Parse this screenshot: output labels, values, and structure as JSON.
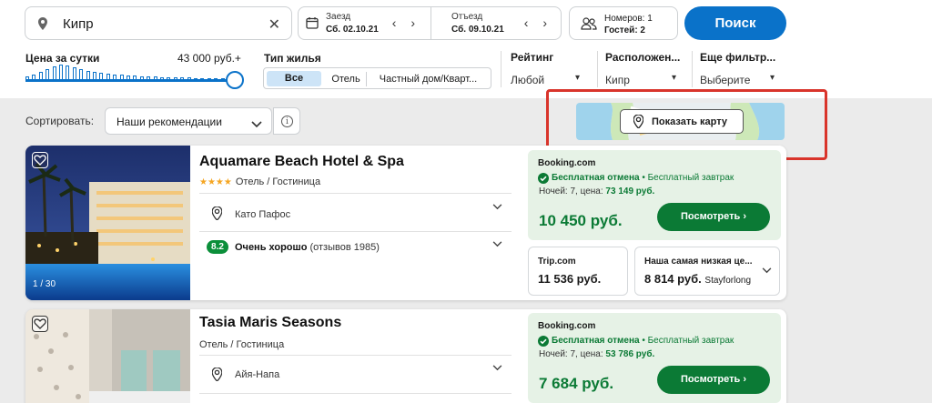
{
  "search": {
    "destination": "Кипр",
    "clear_icon": "close-icon",
    "checkin_label": "Заезд",
    "checkin_value": "Сб. 02.10.21",
    "checkout_label": "Отъезд",
    "checkout_value": "Сб. 09.10.21",
    "rooms": "Номеров: 1",
    "guests": "Гостей: 2",
    "button": "Поиск"
  },
  "filters": {
    "price_label": "Цена за сутки",
    "price_value": "43 000 руб.+",
    "price_slider_level": 1.0,
    "type_label": "Тип жилья",
    "type_options": [
      "Все",
      "Отель",
      "Частный дом/Кварт..."
    ],
    "type_selected": "Все",
    "rating_label": "Рейтинг",
    "rating_value": "Любой",
    "location_label": "Расположен...",
    "location_value": "Кипр",
    "more_label": "Еще фильтр...",
    "more_value": "Выберите"
  },
  "sort": {
    "label": "Сортировать:",
    "value": "Наши рекомендации"
  },
  "map": {
    "button": "Показать карту"
  },
  "hotels": [
    {
      "name": "Aquamare Beach Hotel & Spa",
      "stars": "★★★★",
      "type": "Отель / Гостиница",
      "location": "Като Пафос",
      "score": "8.2",
      "score_text": "Очень хорошо",
      "reviews": "(отзывов 1985)",
      "photo_counter": "1 / 30",
      "deal": {
        "source": "Booking.com",
        "perk_main": "Бесплатная отмена",
        "perk_extra": " • Бесплатный завтрак",
        "nights_prefix": "Ночей: 7, цена: ",
        "nights_total": "73 149 руб.",
        "price": "10 450 руб.",
        "button": "Посмотреть"
      },
      "alternatives": [
        {
          "name": "Trip.com",
          "price": "11 536 руб.",
          "via": ""
        },
        {
          "name": "Наша самая низкая це...",
          "price": "8 814 руб.",
          "via": "Stayforlong"
        }
      ]
    },
    {
      "name": "Tasia Maris Seasons",
      "stars": "",
      "type": "Отель / Гостиница",
      "location": "Айя-Напа",
      "deal": {
        "source": "Booking.com",
        "perk_main": "Бесплатная отмена",
        "perk_extra": " • Бесплатный завтрак",
        "nights_prefix": "Ночей: 7, цена: ",
        "nights_total": "53 786 руб.",
        "price": "7 684 руб.",
        "button": "Посмотреть"
      }
    }
  ],
  "colors": {
    "accent": "#0a72c9",
    "deal_green": "#0b7a35",
    "highlight_frame": "#d9342b"
  }
}
